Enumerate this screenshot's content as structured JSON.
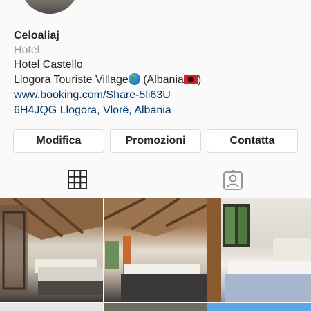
{
  "profile": {
    "username": "Celoaliaj",
    "category": "Hotel",
    "bio_line1": "Hotel Castello",
    "bio_line2_text": "Llogora Touriste Village",
    "bio_line2_suffix": "(Albania",
    "bio_line2_close": ")",
    "website": "www.booking.com/Share-5li63U",
    "address": "6H4JQG Llogora, Vlorë, Albania"
  },
  "actions": {
    "edit_label": "Modifica",
    "promotions_label": "Promozioni",
    "contact_label": "Contatta"
  },
  "tabs": {
    "grid_icon": "grid-icon",
    "tagged_icon": "tagged-person-icon"
  },
  "colors": {
    "accent": "#3897f0",
    "link": "#003569",
    "secondary_text": "#999999"
  }
}
